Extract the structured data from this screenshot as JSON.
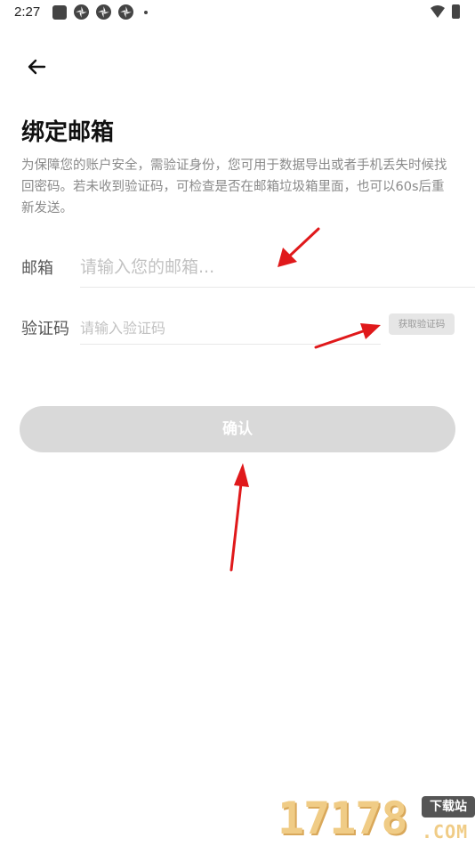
{
  "status_bar": {
    "time": "2:27"
  },
  "header": {
    "title": "绑定邮箱",
    "description": "为保障您的账户安全，需验证身份，您可用于数据导出或者手机丢失时候找回密码。若未收到验证码，可检查是否在邮箱垃圾箱里面，也可以60s后重新发送。"
  },
  "form": {
    "email_label": "邮箱",
    "email_placeholder": "请输入您的邮箱...",
    "email_value": "",
    "code_label": "验证码",
    "code_placeholder": "请输入验证码",
    "code_value": "",
    "get_code_label": "获取验证码",
    "confirm_label": "确认"
  },
  "watermark": {
    "number": "17178",
    "badge": "下载站",
    "suffix": ".COM"
  },
  "colors": {
    "annotation_arrow": "#e0191b",
    "button_disabled": "#d9d9d9"
  }
}
